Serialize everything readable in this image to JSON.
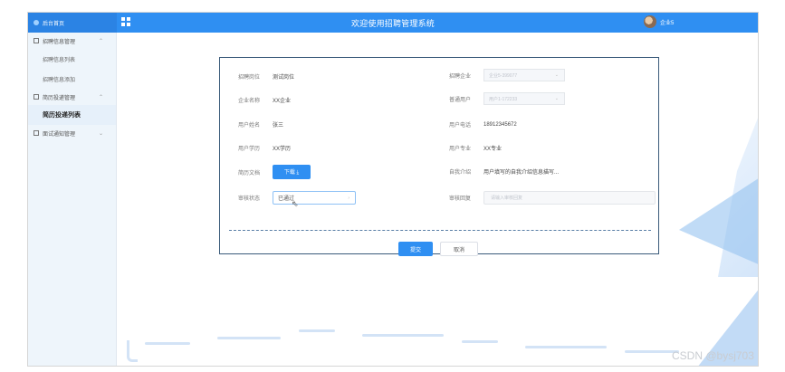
{
  "topbar": {
    "logo_text": "后台首页",
    "title": "欢迎使用招聘管理系统",
    "user_name": "企业5"
  },
  "sidebar": {
    "groups": [
      {
        "label": "招聘信息管理",
        "items": [
          "招聘信息列表",
          "招聘信息添加"
        ]
      },
      {
        "label": "简历投递管理",
        "items": [
          "简历投递列表"
        ]
      },
      {
        "label": "面试通知管理",
        "items": []
      }
    ]
  },
  "form": {
    "left": [
      {
        "label": "招聘岗位",
        "value": "测试岗位"
      },
      {
        "label": "企业名称",
        "value": "XX企业"
      },
      {
        "label": "用户姓名",
        "value": "张三"
      },
      {
        "label": "用户学历",
        "value": "XX学历"
      },
      {
        "label": "简历文档",
        "button": "下载 ⤓"
      },
      {
        "label": "审核状态",
        "select": "已通过"
      }
    ],
    "right": [
      {
        "label": "招聘企业",
        "placeholder": "企业5-399077"
      },
      {
        "label": "普通用户",
        "placeholder": "用户1-172233"
      },
      {
        "label": "用户电话",
        "value": "18912345672"
      },
      {
        "label": "用户专业",
        "value": "XX专业"
      },
      {
        "label": "自我介绍",
        "value": "用户填写的自我介绍信息描写..."
      },
      {
        "label": "审核回复",
        "placeholder": "请输入审核回复"
      }
    ],
    "submit_label": "提交",
    "cancel_label": "取消"
  },
  "watermark": "CSDN @bysj703"
}
